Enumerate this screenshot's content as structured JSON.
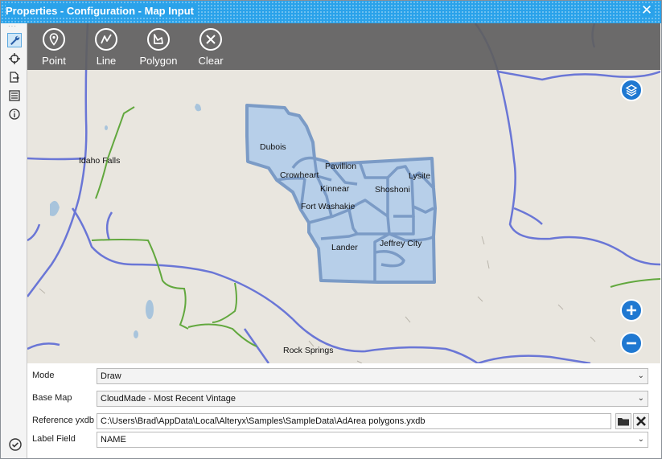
{
  "window": {
    "title": "Properties - Configuration - Map Input"
  },
  "side_tools": [
    "wrench-icon",
    "target-icon",
    "export-icon",
    "list-icon",
    "info-icon"
  ],
  "map_toolbar": {
    "point_label": "Point",
    "line_label": "Line",
    "polygon_label": "Polygon",
    "clear_label": "Clear"
  },
  "map": {
    "labels": {
      "idaho_falls": "Idaho Falls",
      "dubois": "Dubois",
      "pavillion": "Pavillion",
      "crowheart": "Crowheart",
      "lysite": "Lysite",
      "kinnear": "Kinnear",
      "shoshoni": "Shoshoni",
      "fort_washakie": "Fort Washakie",
      "lander": "Lander",
      "jeffrey_city": "Jeffrey City",
      "rock_springs": "Rock Springs"
    },
    "colors": {
      "polygon_fill": "#b7cfe9",
      "polygon_stroke": "#7b9bc6",
      "road_blue": "#6a76d6",
      "road_green": "#62a83e",
      "water": "#a8c4dc"
    }
  },
  "form": {
    "mode": {
      "label": "Mode",
      "value": "Draw"
    },
    "base_map": {
      "label": "Base Map",
      "value": "CloudMade - Most Recent Vintage"
    },
    "reference_yxdb": {
      "label": "Reference yxdb",
      "value": "C:\\Users\\Brad\\AppData\\Local\\Alteryx\\Samples\\SampleData\\AdArea polygons.yxdb"
    },
    "label_field": {
      "label": "Label Field",
      "value": "NAME"
    }
  }
}
